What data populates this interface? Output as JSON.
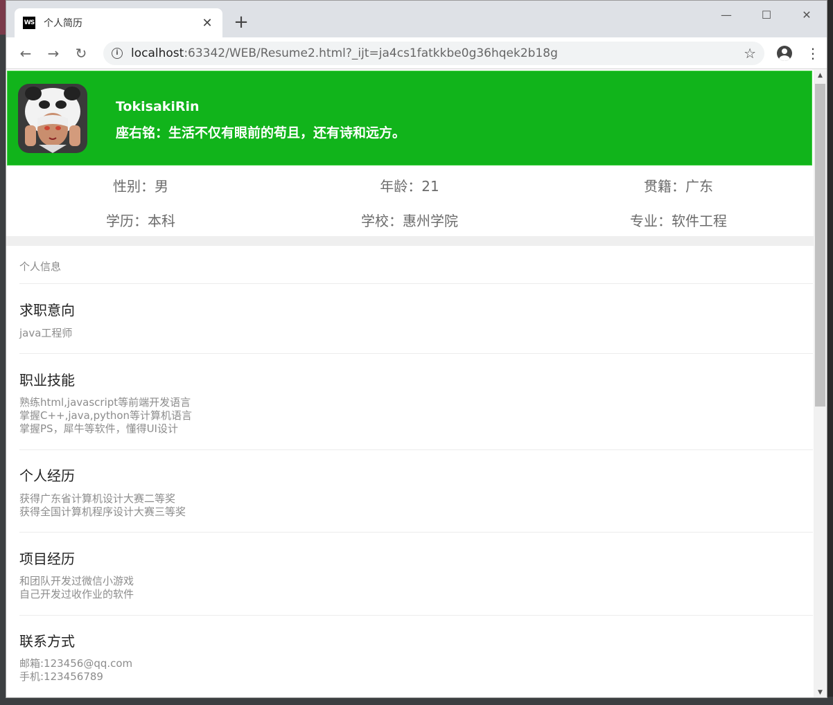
{
  "browser": {
    "tab_title": "个人简历",
    "tab_icon_text": "WS",
    "url_host": "localhost",
    "url_rest": ":63342/WEB/Resume2.html?_ijt=ja4cs1fatkkbe0g36hqek2b18g"
  },
  "profile": {
    "name": "TokisakiRin",
    "motto": "座右铭：生活不仅有眼前的苟且，还有诗和远方。"
  },
  "info": {
    "gender": "性别：男",
    "age": "年龄：21",
    "hometown": "贯籍：广东",
    "education": "学历：本科",
    "school": "学校：惠州学院",
    "major": "专业：软件工程"
  },
  "sections": {
    "label": "个人信息",
    "job": {
      "title": "求职意向",
      "lines": [
        "java工程师"
      ]
    },
    "skills": {
      "title": "职业技能",
      "lines": [
        "熟练html,javascript等前端开发语言",
        "掌握C++,java,python等计算机语言",
        "掌握PS，犀牛等软件，懂得UI设计"
      ]
    },
    "experience": {
      "title": "个人经历",
      "lines": [
        "获得广东省计算机设计大赛二等奖",
        "获得全国计算机程序设计大赛三等奖"
      ]
    },
    "projects": {
      "title": "项目经历",
      "lines": [
        "和团队开发过微信小游戏",
        "自己开发过收作业的软件"
      ]
    },
    "contact": {
      "title": "联系方式",
      "lines": [
        "邮箱:123456@qq.com",
        "手机:123456789"
      ]
    }
  },
  "colors": {
    "header_green": "#11b41b",
    "muted_text": "#8c8c8c"
  }
}
